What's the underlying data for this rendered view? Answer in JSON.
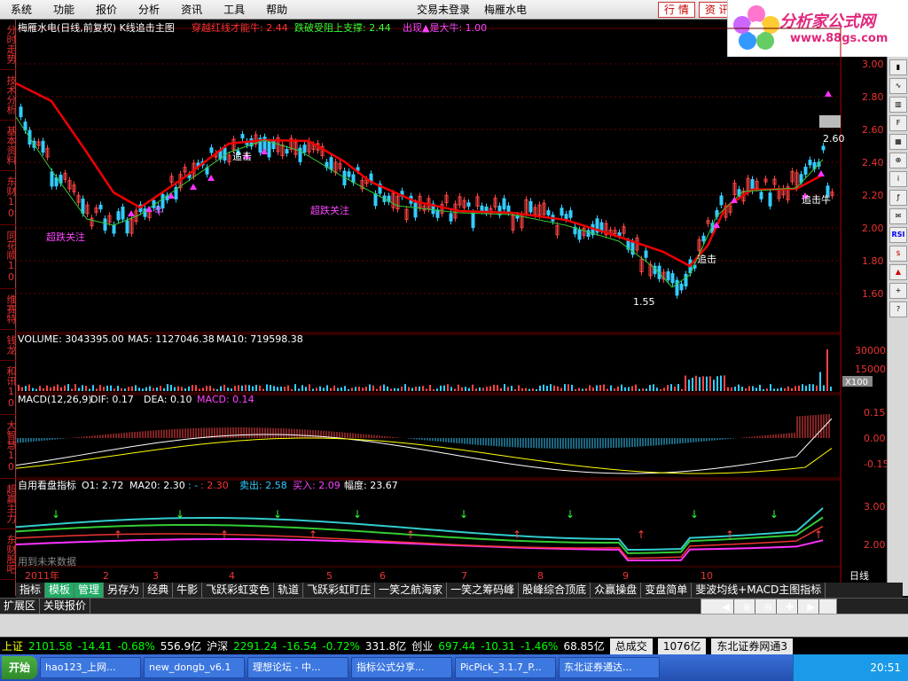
{
  "menu": {
    "items": [
      "系统",
      "功能",
      "报价",
      "分析",
      "资讯",
      "工具",
      "帮助"
    ],
    "center": [
      "交易未登录",
      "梅雁水电"
    ],
    "buttons": [
      "行 情",
      "资 讯"
    ]
  },
  "logo": {
    "text": "分析家公式网",
    "url": "www.88gs.com"
  },
  "leftbar": [
    "分时走势",
    "技术分析",
    "基本资料",
    "东财10",
    "同花顺10",
    "维赛特",
    "钱龙",
    "和讯10",
    "大智慧10",
    "超赢主力",
    "东财股吧"
  ],
  "rightbar": [
    "RSI"
  ],
  "main": {
    "title": "梅雁水电(日线,前复权) K线追击主图",
    "ind1": "穿越红线才能牛: 2.44",
    "ind2": "跌破受阻上支撑: 2.44",
    "ind3": "出现▲是大牛: 1.00",
    "price_axis": [
      "3.00",
      "2.80",
      "2.60",
      "2.40",
      "2.20",
      "2.00",
      "1.80",
      "1.60"
    ],
    "labels": {
      "chaodie1": "超跌关注",
      "chaodie2": "超跌关注",
      "zhuiji1": "追击",
      "zhuiji2": "追击",
      "zhuiji3": "追击牛",
      "niu": "牛",
      "low": "1.55",
      "high": "2.60"
    }
  },
  "volume": {
    "title": "VOLUME: 3043395.00",
    "ma5": "MA5: 1127046.38",
    "ma10": "MA10: 719598.38",
    "axis": [
      "30000",
      "15000"
    ],
    "unit": "X100"
  },
  "macd": {
    "title": "MACD(12,26,9)",
    "dif": "DIF: 0.17",
    "dea": "DEA: 0.10",
    "macd": "MACD: 0.14",
    "axis": [
      "0.15",
      "0.00",
      "-0.15"
    ]
  },
  "zy": {
    "title": "自用看盘指标",
    "o1": "O1: 2.72",
    "ma20": "MA20: 2.30",
    "dash": ": -",
    "neg": ": 2.30",
    "sell": "卖出: 2.58",
    "buy": "买入: 2.09",
    "amp": "幅度: 23.67",
    "axis": [
      "3.00",
      "2.00"
    ],
    "nofuture": "用到未来数据"
  },
  "months": [
    "2011年",
    "2",
    "3",
    "4",
    "5",
    "6",
    "7",
    "8",
    "9",
    "10"
  ],
  "period": "日线",
  "tabs": [
    "指标",
    "模板",
    "管理",
    "另存为",
    "经典",
    "牛影",
    "飞跃彩虹变色",
    "轨道",
    "飞跃彩虹盯庄",
    "一笑之航海家",
    "一笑之筹码峰",
    "股峰综合顶底",
    "众赢操盘",
    "变盘简单",
    "斐波均线+MACD主图指标"
  ],
  "tabs2": [
    "扩展区",
    "关联报价"
  ],
  "ticker": {
    "sh": "上证",
    "sh_v": "2101.58",
    "sh_c": "-14.41",
    "sh_p": "-0.68%",
    "sh_a": "556.9亿",
    "sz": "沪深",
    "sz_v": "2291.24",
    "sz_c": "-16.54",
    "sz_p": "-0.72%",
    "sz_a": "331.8亿",
    "cy": "创业",
    "cy_v": "697.44",
    "cy_c": "-10.31",
    "cy_p": "-1.46%",
    "cy_a": "68.85亿",
    "total": "总成交",
    "total_v": "1076亿",
    "broker": "东北证券网通3"
  },
  "taskbar": {
    "start": "开始",
    "items": [
      "hao123_上网...",
      "new_dongb_v6.1",
      "理想论坛 - 中...",
      "指标公式分享...",
      "PicPick_3.1.7_P...",
      "东北证券通达..."
    ],
    "time": "20:51"
  }
}
